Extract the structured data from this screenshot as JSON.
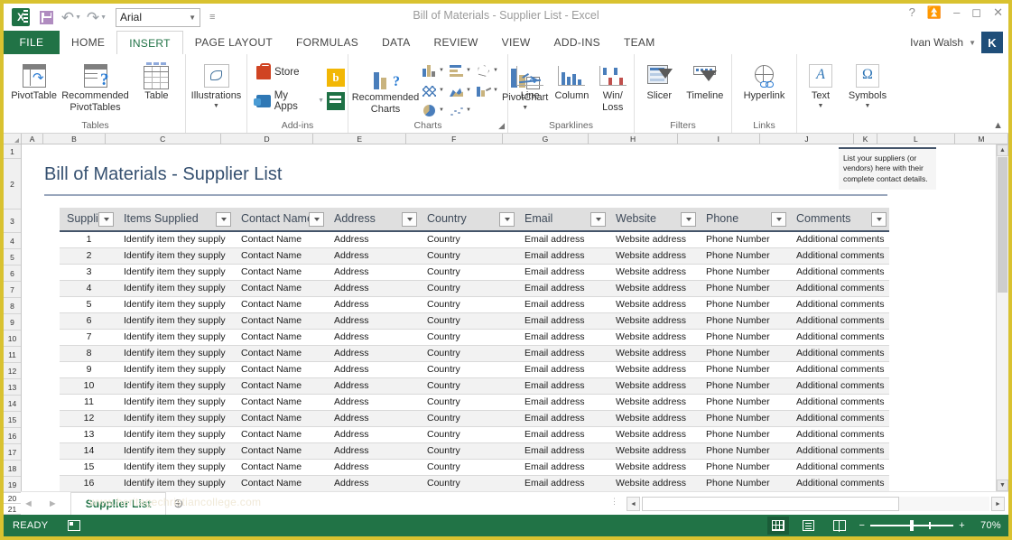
{
  "window": {
    "title": "Bill of Materials - Supplier List - Excel",
    "help_icon": "help-icon",
    "ribbon_display_icon": "ribbon-display-options-icon",
    "minimize_icon": "minimize-icon",
    "maximize_icon": "maximize-icon",
    "close_icon": "close-icon"
  },
  "quick_access": {
    "app_icon": "excel-icon",
    "app_letter": "X",
    "save_icon": "save-icon",
    "undo_icon": "undo-icon",
    "redo_icon": "redo-icon",
    "font_value": "Arial",
    "customize_icon": "customize-quick-access-toolbar-icon"
  },
  "account": {
    "user_name": "Ivan Walsh",
    "avatar_initial": "K"
  },
  "ribbon": {
    "tabs": [
      {
        "label": "FILE",
        "active": false,
        "file": true
      },
      {
        "label": "HOME",
        "active": false
      },
      {
        "label": "INSERT",
        "active": true
      },
      {
        "label": "PAGE LAYOUT",
        "active": false
      },
      {
        "label": "FORMULAS",
        "active": false
      },
      {
        "label": "DATA",
        "active": false
      },
      {
        "label": "REVIEW",
        "active": false
      },
      {
        "label": "VIEW",
        "active": false
      },
      {
        "label": "ADD-INS",
        "active": false
      },
      {
        "label": "TEAM",
        "active": false
      }
    ],
    "groups": {
      "tables": {
        "label": "Tables",
        "pivottable": "PivotTable",
        "recommended_pivottables": "Recommended\nPivotTables",
        "recommended_line1": "Recommended",
        "recommended_line2": "PivotTables",
        "table": "Table"
      },
      "illustrations": {
        "label": "",
        "illustrations": "Illustrations"
      },
      "addins": {
        "label": "Add-ins",
        "store": "Store",
        "my_apps": "My Apps",
        "bing_letter": "b"
      },
      "charts": {
        "label": "Charts",
        "recommended_charts_line1": "Recommended",
        "recommended_charts_line2": "Charts",
        "pivotchart": "PivotChart"
      },
      "sparklines": {
        "label": "Sparklines",
        "line": "Line",
        "column": "Column",
        "winloss_line1": "Win/",
        "winloss_line2": "Loss"
      },
      "filters": {
        "label": "Filters",
        "slicer": "Slicer",
        "timeline": "Timeline"
      },
      "links": {
        "label": "Links",
        "hyperlink": "Hyperlink"
      },
      "text": {
        "label": "",
        "text": "Text",
        "text_glyph": "A",
        "symbols": "Symbols",
        "symbols_glyph": "Ω"
      }
    }
  },
  "grid": {
    "column_letters": [
      "A",
      "B",
      "C",
      "D",
      "E",
      "F",
      "G",
      "H",
      "I",
      "J",
      "K",
      "L",
      "M"
    ],
    "row_numbers": [
      "1",
      "2",
      "3",
      "4",
      "5",
      "6",
      "7",
      "8",
      "9",
      "10",
      "11",
      "12",
      "13",
      "14",
      "15",
      "16",
      "17",
      "18",
      "19",
      "20",
      "21"
    ]
  },
  "sheet": {
    "title": "Bill of Materials - Supplier List",
    "note": "List your suppliers (or vendors) here with their complete contact details.",
    "table": {
      "headers": [
        "Supplier",
        "Items Supplied",
        "Contact Name",
        "Address",
        "Country",
        "Email",
        "Website",
        "Phone",
        "Comments"
      ],
      "rows": [
        [
          "1",
          "Identify item they supply",
          "Contact Name",
          "Address",
          "Country",
          "Email address",
          "Website address",
          "Phone Number",
          "Additional comments"
        ],
        [
          "2",
          "Identify item they supply",
          "Contact Name",
          "Address",
          "Country",
          "Email address",
          "Website address",
          "Phone Number",
          "Additional comments"
        ],
        [
          "3",
          "Identify item they supply",
          "Contact Name",
          "Address",
          "Country",
          "Email address",
          "Website address",
          "Phone Number",
          "Additional comments"
        ],
        [
          "4",
          "Identify item they supply",
          "Contact Name",
          "Address",
          "Country",
          "Email address",
          "Website address",
          "Phone Number",
          "Additional comments"
        ],
        [
          "5",
          "Identify item they supply",
          "Contact Name",
          "Address",
          "Country",
          "Email address",
          "Website address",
          "Phone Number",
          "Additional comments"
        ],
        [
          "6",
          "Identify item they supply",
          "Contact Name",
          "Address",
          "Country",
          "Email address",
          "Website address",
          "Phone Number",
          "Additional comments"
        ],
        [
          "7",
          "Identify item they supply",
          "Contact Name",
          "Address",
          "Country",
          "Email address",
          "Website address",
          "Phone Number",
          "Additional comments"
        ],
        [
          "8",
          "Identify item they supply",
          "Contact Name",
          "Address",
          "Country",
          "Email address",
          "Website address",
          "Phone Number",
          "Additional comments"
        ],
        [
          "9",
          "Identify item they supply",
          "Contact Name",
          "Address",
          "Country",
          "Email address",
          "Website address",
          "Phone Number",
          "Additional comments"
        ],
        [
          "10",
          "Identify item they supply",
          "Contact Name",
          "Address",
          "Country",
          "Email address",
          "Website address",
          "Phone Number",
          "Additional comments"
        ],
        [
          "11",
          "Identify item they supply",
          "Contact Name",
          "Address",
          "Country",
          "Email address",
          "Website address",
          "Phone Number",
          "Additional comments"
        ],
        [
          "12",
          "Identify item they supply",
          "Contact Name",
          "Address",
          "Country",
          "Email address",
          "Website address",
          "Phone Number",
          "Additional comments"
        ],
        [
          "13",
          "Identify item they supply",
          "Contact Name",
          "Address",
          "Country",
          "Email address",
          "Website address",
          "Phone Number",
          "Additional comments"
        ],
        [
          "14",
          "Identify item they supply",
          "Contact Name",
          "Address",
          "Country",
          "Email address",
          "Website address",
          "Phone Number",
          "Additional comments"
        ],
        [
          "15",
          "Identify item they supply",
          "Contact Name",
          "Address",
          "Country",
          "Email address",
          "Website address",
          "Phone Number",
          "Additional comments"
        ],
        [
          "16",
          "Identify item they supply",
          "Contact Name",
          "Address",
          "Country",
          "Email address",
          "Website address",
          "Phone Number",
          "Additional comments"
        ]
      ]
    }
  },
  "sheet_tabs": {
    "active_tab": "Supplier List",
    "add_sheet_icon": "add-sheet-icon",
    "prev_icon": "previous-sheet-icon",
    "next_icon": "next-sheet-icon",
    "watermark": "www.heritagechristiancollege.com"
  },
  "status_bar": {
    "state": "READY",
    "macro_icon": "record-macro-icon",
    "view_normal_icon": "normal-view-icon",
    "view_page_layout_icon": "page-layout-view-icon",
    "view_page_break_icon": "page-break-preview-icon",
    "zoom_out_label": "−",
    "zoom_in_label": "+",
    "zoom_level": "70%"
  },
  "colors": {
    "excel_green": "#217346",
    "title_blue": "#355070",
    "table_header_rule": "#44546a",
    "window_border": "#d9c230"
  }
}
